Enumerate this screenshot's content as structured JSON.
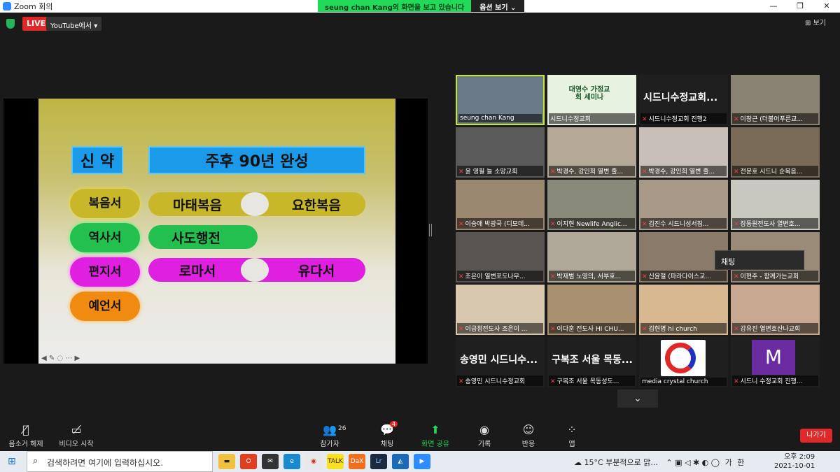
{
  "window": {
    "title": "Zoom 회의"
  },
  "share_banner": {
    "text": "seung chan Kang의 화면을 보고 있습니다",
    "options": "옵션 보기"
  },
  "topbar": {
    "live": "LIVE",
    "stream": "YouTube에서",
    "view": "보기"
  },
  "slide": {
    "header_left": "신 약",
    "header_right": "주후 90년 완성",
    "categories": [
      "복음서",
      "역사서",
      "편지서",
      "예언서"
    ],
    "gospels": [
      "마태복음",
      "요한복음"
    ],
    "acts": "사도행전",
    "letters": [
      "로마서",
      "유다서"
    ]
  },
  "participants": [
    {
      "name": "seung chan Kang",
      "muted": false
    },
    {
      "name": "시드니수정교회",
      "muted": false,
      "tile": "대영수 가정교회 세미나"
    },
    {
      "name": "시드니수정교회 진행2",
      "muted": true,
      "big": "시드니수정교회..."
    },
    {
      "name": "이창근 (더불어푸른교...",
      "muted": true
    },
    {
      "name": "윤 영필 늘 소망교회",
      "muted": true
    },
    {
      "name": "박경수, 강인희 열변 줄...",
      "muted": true
    },
    {
      "name": "박경수, 강인희 열변 줄...",
      "muted": true
    },
    {
      "name": "전문호 시드니 순복음...",
      "muted": true
    },
    {
      "name": "이승애 박광국 (디모데...",
      "muted": true
    },
    {
      "name": "이지현 Newlife Anglic...",
      "muted": true
    },
    {
      "name": "김진수 시드니성서침...",
      "muted": true
    },
    {
      "name": "장동원전도사 열변호...",
      "muted": true
    },
    {
      "name": "조은이 열변포도나무...",
      "muted": true
    },
    {
      "name": "박재범 노영의, 서부호...",
      "muted": true
    },
    {
      "name": "신윤철 (파라다이스교...",
      "muted": true
    },
    {
      "name": "이현주 - 함께가는교회",
      "muted": true
    },
    {
      "name": "이금정전도사 조은이 ...",
      "muted": true
    },
    {
      "name": "이다훈 전도사 HI CHU...",
      "muted": true
    },
    {
      "name": "김현명 hi church",
      "muted": true
    },
    {
      "name": "강유진 열변호산나교회",
      "muted": true
    },
    {
      "name": "송영민 시드니수정교회",
      "muted": true,
      "big": "송영민 시드니수..."
    },
    {
      "name": "구복조 서울 목동성도...",
      "muted": true,
      "big": "구복조 서울 목동..."
    },
    {
      "name": "media crystal church",
      "muted": false
    },
    {
      "name": "시드니 수정교회 진행...",
      "muted": true,
      "big": "M"
    }
  ],
  "chat_tooltip": "채팅",
  "toolbar": {
    "unmute": "음소거 해제",
    "video": "비디오 시작",
    "participants": "참가자",
    "participants_count": "26",
    "chat": "채팅",
    "chat_badge": "4",
    "share": "화면 공유",
    "record": "기록",
    "reactions": "반응",
    "apps": "앱",
    "leave": "나가기"
  },
  "taskbar": {
    "search_placeholder": "검색하려면 여기에 입력하십시오.",
    "weather": "15°C  부분적으로 맑...",
    "ime": "가",
    "lang": "한",
    "time": "오후 2:09",
    "date": "2021-10-01"
  }
}
